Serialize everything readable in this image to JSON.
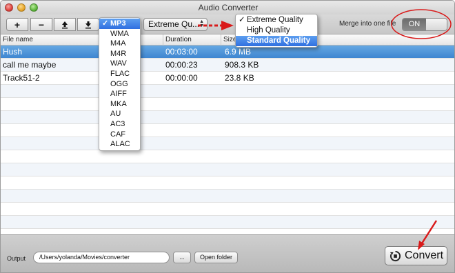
{
  "window": {
    "title": "Audio Converter"
  },
  "toolbar": {
    "buttons": [
      {
        "name": "add-button",
        "glyph": "+"
      },
      {
        "name": "remove-button",
        "glyph": "−"
      },
      {
        "name": "move-up-button",
        "glyph": ""
      },
      {
        "name": "move-down-button",
        "glyph": ""
      }
    ],
    "quality_select_value": "Extreme Qu...",
    "merge_label": "Merge into one file",
    "merge_toggle": "ON"
  },
  "format_menu": {
    "items": [
      "MP3",
      "WMA",
      "M4A",
      "M4R",
      "WAV",
      "FLAC",
      "OGG",
      "AIFF",
      "MKA",
      "AU",
      "AC3",
      "CAF",
      "ALAC"
    ],
    "selected": "MP3",
    "check": "✓"
  },
  "quality_menu": {
    "items": [
      "Extreme Quality",
      "High Quality",
      "Standard Quality"
    ],
    "checked": "Extreme Quality",
    "highlighted": "Standard Quality",
    "check": "✓"
  },
  "table": {
    "columns": [
      "File name",
      "Duration",
      "Size"
    ],
    "rows": [
      {
        "name": "Hush",
        "duration": "00:03:00",
        "size": "6.9 MB",
        "selected": true
      },
      {
        "name": "call me maybe",
        "duration": "00:00:23",
        "size": "908.3 KB",
        "selected": false
      },
      {
        "name": "Track51-2",
        "duration": "00:00:00",
        "size": "23.8 KB",
        "selected": false
      }
    ]
  },
  "bottom": {
    "output_label": "Output",
    "output_path": "/Users/yolanda/Movies/converter",
    "browse_label": "...",
    "open_folder_label": "Open folder",
    "convert_label": "Convert"
  },
  "colors": {
    "selection": "#3f86d1",
    "annotation": "#d91a1a"
  }
}
